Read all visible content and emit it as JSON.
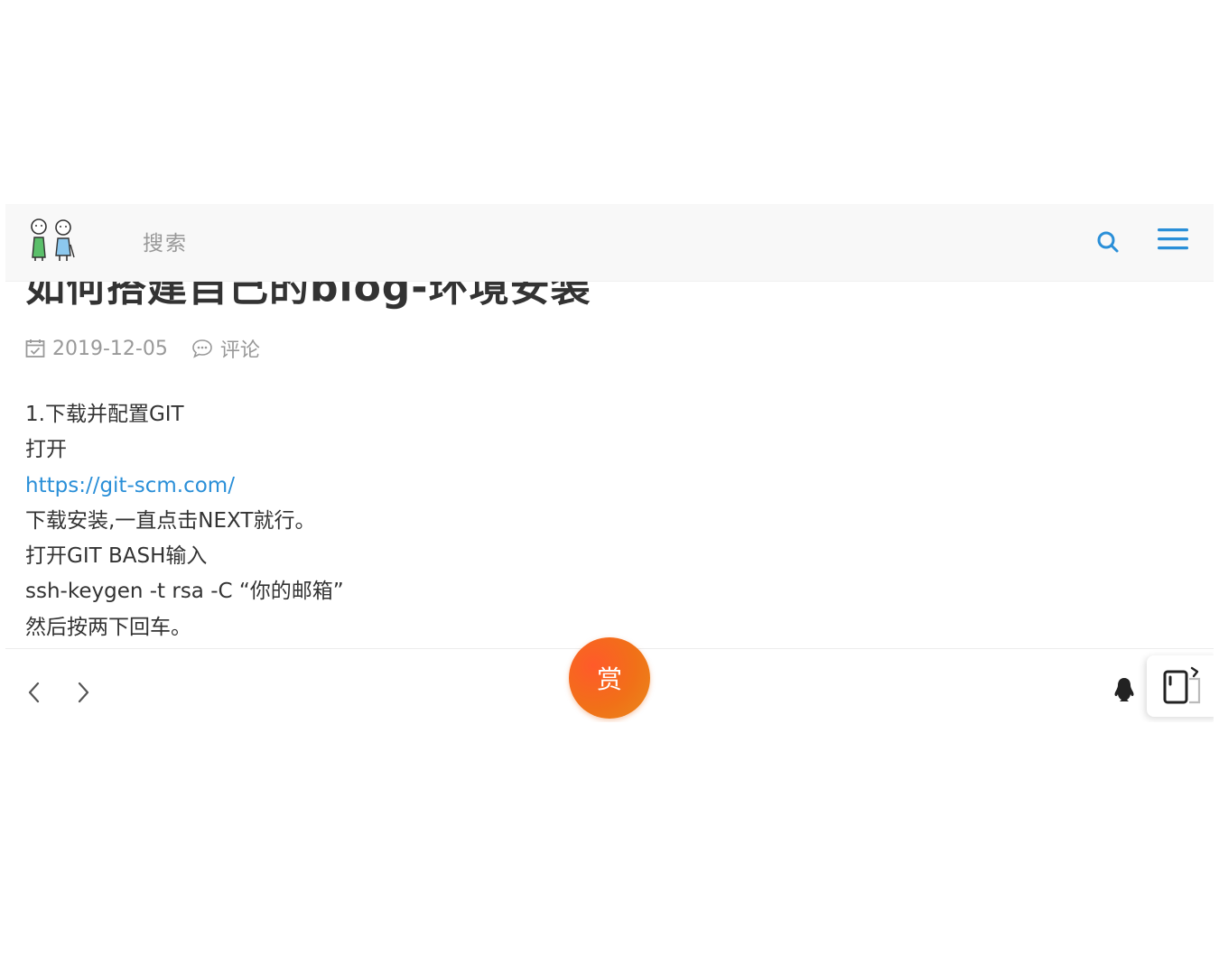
{
  "header": {
    "search_placeholder": "搜索"
  },
  "post": {
    "title": "如何搭建自己的blog-环境安装",
    "date": "2019-12-05",
    "comments_label": "评论",
    "content": {
      "line1": "1.下载并配置GIT",
      "line2": "打开",
      "link": "https://git-scm.com/",
      "line4": "下载安装,一直点击NEXT就行。",
      "line5": "打开GIT BASH输入",
      "line6": "ssh-keygen -t rsa -C “你的邮箱”",
      "line7": "然后按两下回车。"
    }
  },
  "footer": {
    "reward_label": "赏"
  },
  "colors": {
    "accent": "#2a8fd8",
    "reward": "#f17018"
  },
  "icons": {
    "search": "search-icon",
    "menu": "hamburger-menu-icon",
    "calendar": "calendar-icon",
    "comment": "comment-bubble-icon",
    "prev": "chevron-left-icon",
    "next": "chevron-right-icon",
    "qq": "qq-penguin-icon",
    "share": "share-card-icon"
  }
}
